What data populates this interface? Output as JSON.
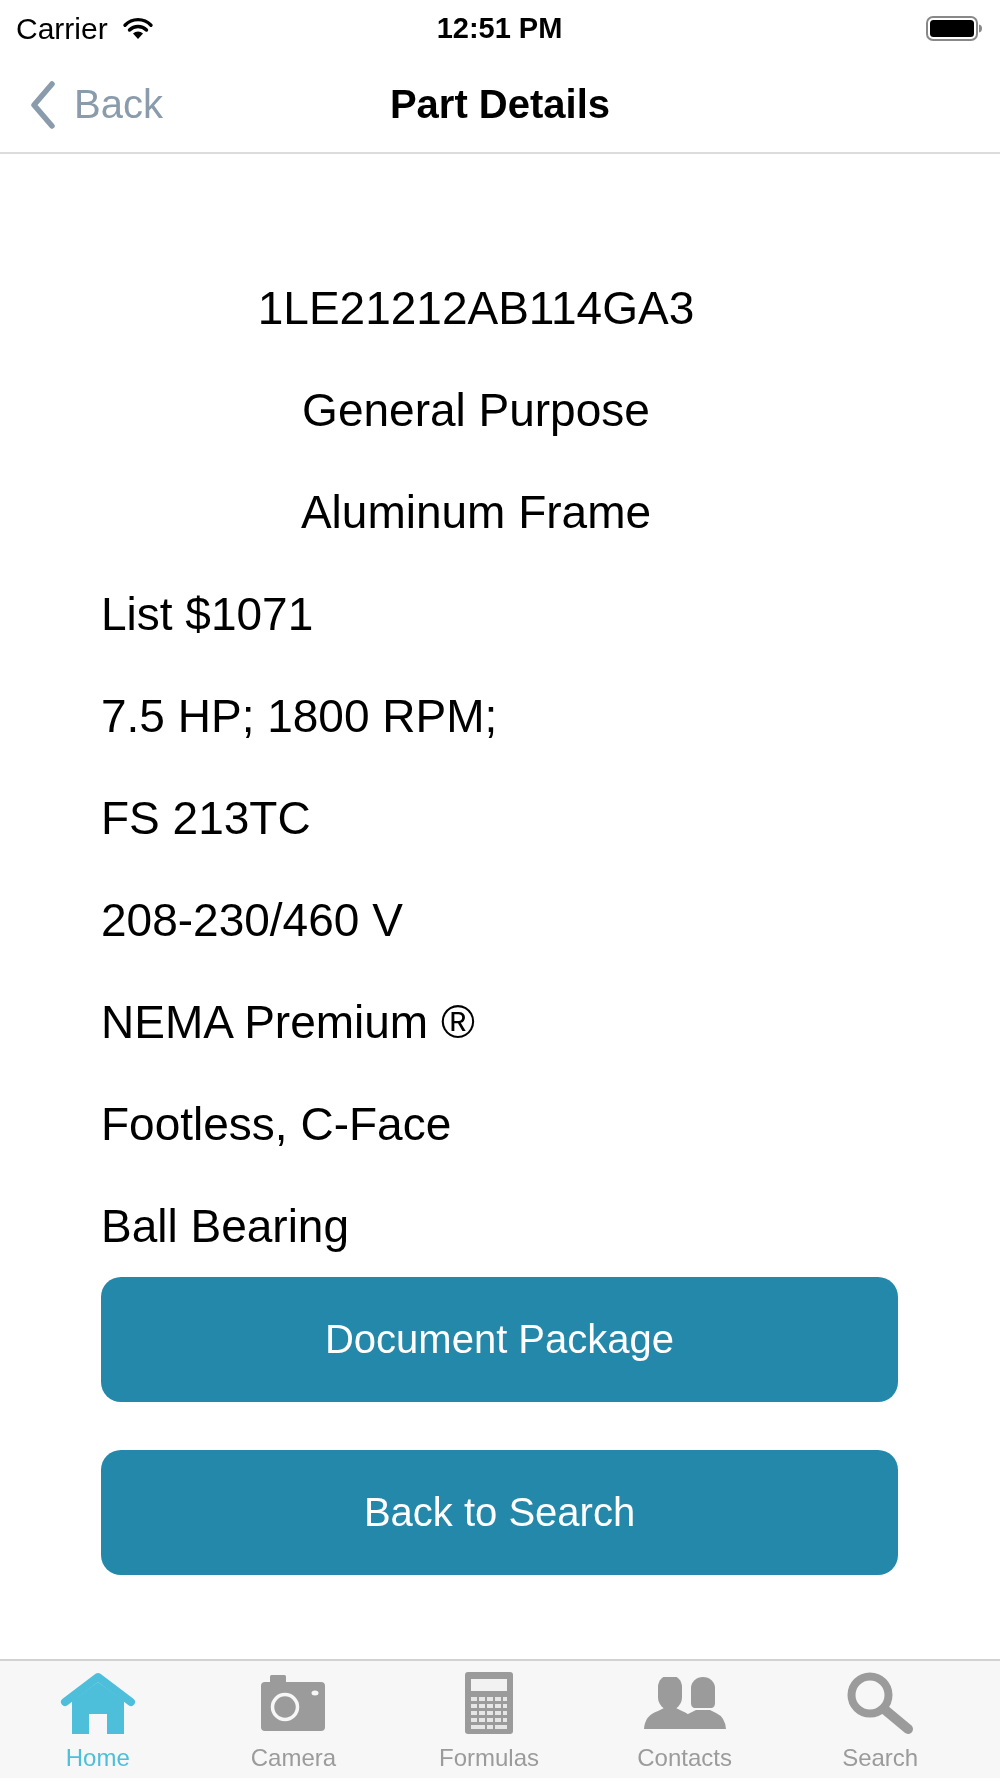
{
  "status_bar": {
    "carrier": "Carrier",
    "time": "12:51 PM"
  },
  "nav_bar": {
    "back_label": "Back",
    "title": "Part Details"
  },
  "part": {
    "number": "1LE21212AB114GA3",
    "headings": [
      "General Purpose",
      "Aluminum Frame"
    ],
    "specs": [
      "List $1071",
      "7.5 HP; 1800 RPM;",
      "FS 213TC",
      "208-230/460 V",
      "NEMA Premium ®",
      "Footless, C-Face",
      "Ball Bearing"
    ]
  },
  "buttons": [
    {
      "label": "Document Package"
    },
    {
      "label": "Back to Search"
    }
  ],
  "tab_bar": [
    {
      "kind": "home",
      "label": "Home",
      "selected": true
    },
    {
      "kind": "camera",
      "label": "Camera",
      "selected": false
    },
    {
      "kind": "formulas",
      "label": "Formulas",
      "selected": false
    },
    {
      "kind": "contacts",
      "label": "Contacts",
      "selected": false
    },
    {
      "kind": "search",
      "label": "Search",
      "selected": false
    }
  ]
}
